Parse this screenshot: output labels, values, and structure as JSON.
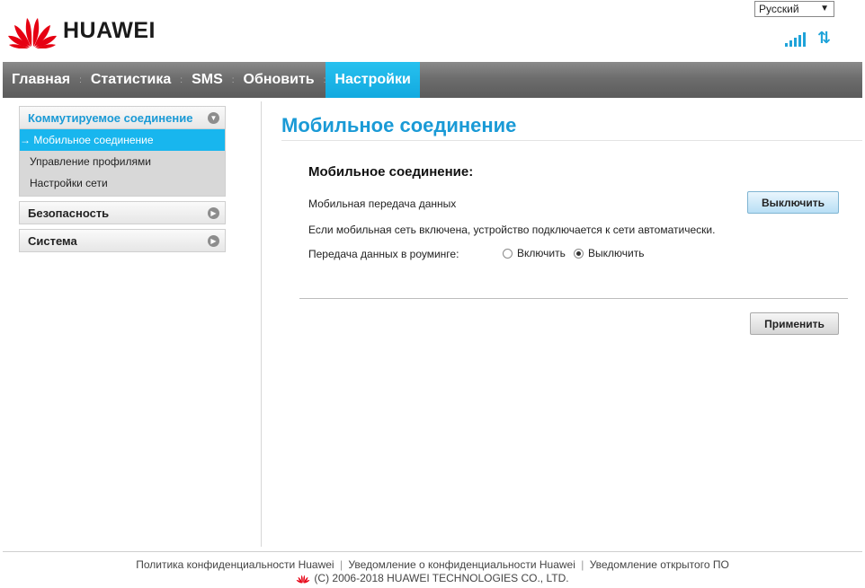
{
  "header": {
    "brand": "HUAWEI",
    "language": "Русский",
    "language_arrow": "▼",
    "transfer_icon": "⇅"
  },
  "nav": {
    "items": [
      {
        "label": "Главная",
        "active": false
      },
      {
        "label": "Статистика",
        "active": false
      },
      {
        "label": "SMS",
        "active": false
      },
      {
        "label": "Обновить",
        "active": false
      },
      {
        "label": "Настройки",
        "active": true
      }
    ],
    "separator": ":"
  },
  "sidebar": {
    "groups": [
      {
        "label": "Коммутируемое соединение",
        "open": true,
        "items": [
          {
            "label": "→ Мобильное соединение",
            "active": true
          },
          {
            "label": "Управление профилями",
            "active": false
          },
          {
            "label": "Настройки сети",
            "active": false
          }
        ]
      },
      {
        "label": "Безопасность",
        "open": false
      },
      {
        "label": "Система",
        "open": false
      }
    ]
  },
  "main": {
    "page_title": "Мобильное соединение",
    "section_title": "Мобильное соединение:",
    "mobile_data_label": "Мобильная передача данных",
    "mobile_data_button": "Выключить",
    "auto_connect_note": "Если мобильная сеть включена, устройство подключается к сети автоматически.",
    "roaming_label": "Передача данных в роуминге:",
    "roaming_on": "Включить",
    "roaming_off": "Выключить",
    "roaming_selected": "off",
    "apply_button": "Применить"
  },
  "footer": {
    "link1": "Политика конфиденциальности Huawei",
    "link2": "Уведомление о конфиденциальности Huawei",
    "link3": "Уведомление открытого ПО",
    "separator": "|",
    "copyright": "(C) 2006-2018 HUAWEI TECHNOLOGIES CO., LTD."
  },
  "colors": {
    "accent": "#1a9ad6",
    "active_tab": "#12a9df",
    "nav_bg": "#6d6d6d",
    "brand_red": "#e60012"
  },
  "icons": {
    "logo": "huawei-flower-logo",
    "signal": "signal-strength-icon",
    "transfer": "data-transfer-icon",
    "expand_open": "chevron-down-circle-icon",
    "expand_closed": "chevron-right-circle-icon"
  }
}
